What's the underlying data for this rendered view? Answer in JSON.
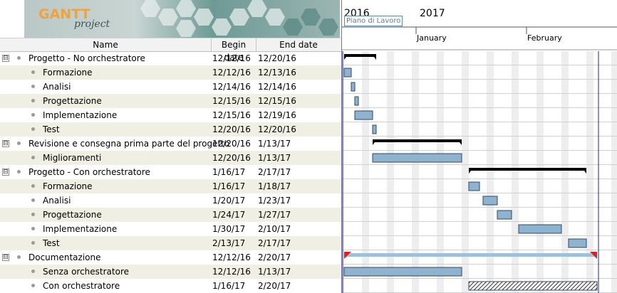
{
  "logo": {
    "word": "GANTT",
    "sub": "project"
  },
  "table": {
    "headers": {
      "name": "Name",
      "begin": "Begin date",
      "end": "End date"
    },
    "rows": [
      {
        "name": "Progetto - No orchestratore",
        "begin": "12/12/16",
        "end": "12/20/16",
        "level": 0,
        "group": true
      },
      {
        "name": "Formazione",
        "begin": "12/12/16",
        "end": "12/13/16",
        "level": 1,
        "group": false
      },
      {
        "name": "Analisi",
        "begin": "12/14/16",
        "end": "12/14/16",
        "level": 1,
        "group": false
      },
      {
        "name": "Progettazione",
        "begin": "12/15/16",
        "end": "12/15/16",
        "level": 1,
        "group": false
      },
      {
        "name": "Implementazione",
        "begin": "12/15/16",
        "end": "12/19/16",
        "level": 1,
        "group": false
      },
      {
        "name": "Test",
        "begin": "12/20/16",
        "end": "12/20/16",
        "level": 1,
        "group": false
      },
      {
        "name": "Revisione e consegna prima parte del progetto",
        "begin": "12/20/16",
        "end": "1/13/17",
        "level": 0,
        "group": true
      },
      {
        "name": "Miglioramenti",
        "begin": "12/20/16",
        "end": "1/13/17",
        "level": 1,
        "group": false
      },
      {
        "name": "Progetto - Con orchestratore",
        "begin": "1/16/17",
        "end": "2/17/17",
        "level": 0,
        "group": true
      },
      {
        "name": "Formazione",
        "begin": "1/16/17",
        "end": "1/18/17",
        "level": 1,
        "group": false
      },
      {
        "name": "Analisi",
        "begin": "1/20/17",
        "end": "1/23/17",
        "level": 1,
        "group": false
      },
      {
        "name": "Progettazione",
        "begin": "1/24/17",
        "end": "1/27/17",
        "level": 1,
        "group": false
      },
      {
        "name": "Implementazione",
        "begin": "1/30/17",
        "end": "2/10/17",
        "level": 1,
        "group": false
      },
      {
        "name": "Test",
        "begin": "2/13/17",
        "end": "2/17/17",
        "level": 1,
        "group": false
      },
      {
        "name": "Documentazione",
        "begin": "12/12/16",
        "end": "2/20/17",
        "level": 0,
        "group": true
      },
      {
        "name": "Senza orchestratore",
        "begin": "12/12/16",
        "end": "1/13/17",
        "level": 1,
        "group": false
      },
      {
        "name": "Con orchestratore",
        "begin": "1/16/17",
        "end": "2/20/17",
        "level": 1,
        "group": false
      }
    ],
    "toggle_symbol": "⊟"
  },
  "timeline": {
    "year_2016": "2016",
    "year_2017": "2017",
    "milestone_label": "Piano di Lavoro",
    "month_jan": "January",
    "month_feb": "February"
  },
  "colors": {
    "task_bar": "#8fb3cf",
    "task_border": "#2e4a66",
    "summary_bar": "#000000",
    "weekend": "#eeeeee",
    "today_line": "#2020a0",
    "doc_bar": "#9ec0da",
    "doc_marker": "#e02020"
  }
}
